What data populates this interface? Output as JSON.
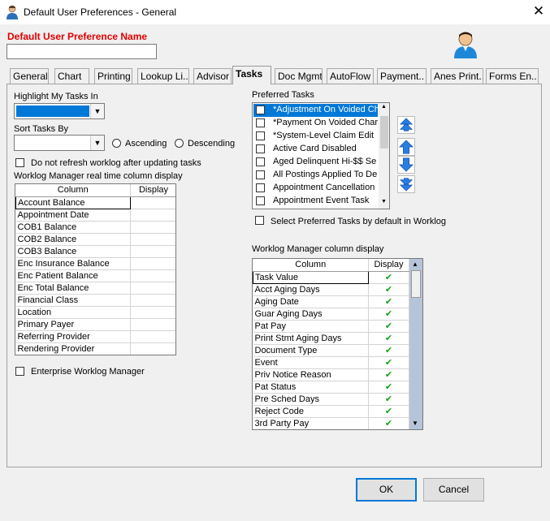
{
  "window": {
    "title": "Default User Preferences - General",
    "close_glyph": "✕"
  },
  "name_section": {
    "label": "Default User Preference Name",
    "value": ""
  },
  "tabs": [
    {
      "label": "General"
    },
    {
      "label": "Chart"
    },
    {
      "label": "Printing"
    },
    {
      "label": "Lookup Li.."
    },
    {
      "label": "Advisor"
    },
    {
      "label": "Tasks"
    },
    {
      "label": "Doc Mgmt"
    },
    {
      "label": "AutoFlow"
    },
    {
      "label": "Payment.."
    },
    {
      "label": "Anes Print.."
    },
    {
      "label": "Forms En.."
    }
  ],
  "active_tab": "Tasks",
  "highlight": {
    "label": "Highlight My Tasks In",
    "selected_color": "#0078d7"
  },
  "sort": {
    "label": "Sort Tasks By",
    "value": "",
    "ascending_label": "Ascending",
    "descending_label": "Descending"
  },
  "no_refresh_label": "Do not refresh worklog after updating tasks",
  "realtime_grid": {
    "title": "Worklog Manager real time column display",
    "headers": [
      "Column",
      "Display"
    ],
    "rows": [
      {
        "column": "Account Balance"
      },
      {
        "column": "Appointment Date"
      },
      {
        "column": "COB1 Balance"
      },
      {
        "column": "COB2 Balance"
      },
      {
        "column": "COB3 Balance"
      },
      {
        "column": "Enc Insurance Balance"
      },
      {
        "column": "Enc Patient Balance"
      },
      {
        "column": "Enc Total Balance"
      },
      {
        "column": "Financial Class"
      },
      {
        "column": "Location"
      },
      {
        "column": "Primary Payer"
      },
      {
        "column": "Referring Provider"
      },
      {
        "column": "Rendering Provider"
      }
    ]
  },
  "enterprise_label": "Enterprise Worklog Manager",
  "preferred_tasks": {
    "title": "Preferred Tasks",
    "items": [
      {
        "label": "*Adjustment On Voided Ch"
      },
      {
        "label": "*Payment On Voided Char"
      },
      {
        "label": "*System-Level Claim Edit"
      },
      {
        "label": "Active Card Disabled"
      },
      {
        "label": "Aged Delinquent Hi-$$ Se"
      },
      {
        "label": "All Postings Applied To De"
      },
      {
        "label": "Appointment Cancellation"
      },
      {
        "label": "Appointment Event Task"
      }
    ],
    "default_label": "Select Preferred Tasks by default in Worklog"
  },
  "worklog_grid": {
    "title": "Worklog Manager column display",
    "headers": [
      "Column",
      "Display"
    ],
    "rows": [
      {
        "column": "Task Value",
        "display": "✔"
      },
      {
        "column": "Acct Aging Days",
        "display": "✔"
      },
      {
        "column": "Aging Date",
        "display": "✔"
      },
      {
        "column": "Guar Aging Days",
        "display": "✔"
      },
      {
        "column": "Pat Pay",
        "display": "✔"
      },
      {
        "column": "Print Stmt Aging Days",
        "display": "✔"
      },
      {
        "column": "Document Type",
        "display": "✔"
      },
      {
        "column": "Event",
        "display": "✔"
      },
      {
        "column": "Priv Notice Reason",
        "display": "✔"
      },
      {
        "column": "Pat Status",
        "display": "✔"
      },
      {
        "column": "Pre Sched Days",
        "display": "✔"
      },
      {
        "column": "Reject Code",
        "display": "✔"
      },
      {
        "column": "3rd Party Pay",
        "display": "✔"
      }
    ]
  },
  "buttons": {
    "ok": "OK",
    "cancel": "Cancel"
  },
  "icons": {
    "app": "user-icon",
    "avatar": "user-avatar-icon"
  }
}
